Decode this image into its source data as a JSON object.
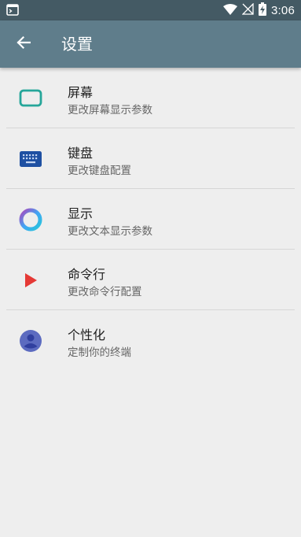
{
  "status_bar": {
    "time": "3:06"
  },
  "app_bar": {
    "title": "设置"
  },
  "settings": [
    {
      "title": "屏幕",
      "subtitle": "更改屏幕显示参数",
      "icon": "screen-icon"
    },
    {
      "title": "键盘",
      "subtitle": "更改键盘配置",
      "icon": "keyboard-icon"
    },
    {
      "title": "显示",
      "subtitle": "更改文本显示参数",
      "icon": "display-ring-icon"
    },
    {
      "title": "命令行",
      "subtitle": "更改命令行配置",
      "icon": "play-icon"
    },
    {
      "title": "个性化",
      "subtitle": "定制你的终端",
      "icon": "person-icon"
    }
  ],
  "colors": {
    "status_bar": "#445a64",
    "app_bar": "#5f7d8b",
    "screen_icon": "#26a69a",
    "keyboard_icon": "#1e50a2",
    "play_icon": "#e53935",
    "person_icon": "#5c6bc0"
  }
}
